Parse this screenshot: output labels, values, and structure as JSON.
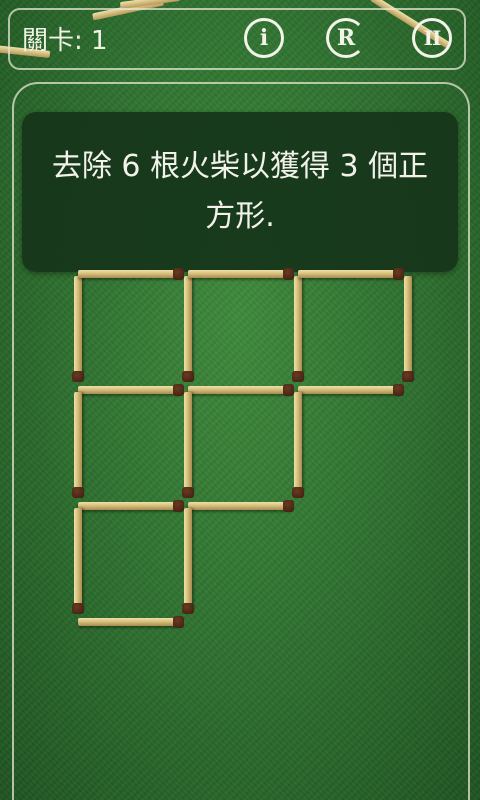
{
  "header": {
    "level_text": "關卡: 1",
    "info_icon": "i",
    "restart_icon": "R",
    "pause_icon": "II"
  },
  "puzzle": {
    "instruction": "去除 6 根火柴以獲得 3 個正方形.",
    "sticks_to_remove": 6,
    "target_squares": 3,
    "grid_rows": [
      3,
      2,
      1
    ],
    "matchstick_count": 22
  },
  "colors": {
    "felt_green": "#2f7330",
    "panel_dark_green": "#16341a",
    "match_wood": "#d7c07e",
    "match_head": "#4a2616"
  }
}
